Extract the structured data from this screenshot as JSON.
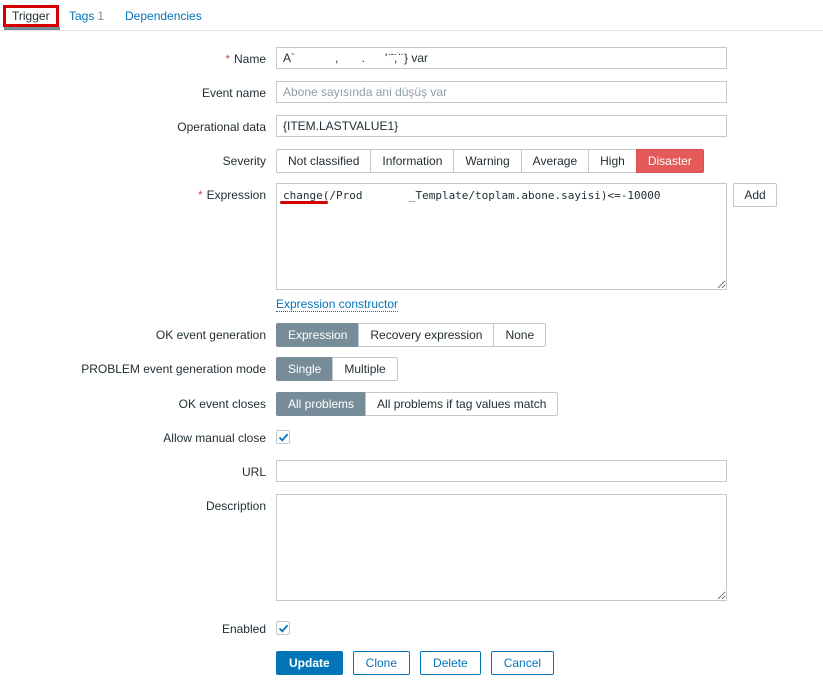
{
  "tabs": {
    "trigger": "Trigger",
    "tags": "Tags",
    "tags_count": "1",
    "dependencies": "Dependencies"
  },
  "form": {
    "name": {
      "label": "Name",
      "value": "A`            ,       .      ' ̈ ̈, ̈ } var"
    },
    "event_name": {
      "label": "Event name",
      "placeholder": "Abone sayısında ani düşüş var"
    },
    "operational_data": {
      "label": "Operational data",
      "value": "{ITEM.LASTVALUE1}"
    },
    "severity": {
      "label": "Severity",
      "options": [
        "Not classified",
        "Information",
        "Warning",
        "Average",
        "High",
        "Disaster"
      ],
      "selected": "Disaster",
      "selected_color": "#e45959"
    },
    "expression": {
      "label": "Expression",
      "value": "change(/Prod       _Template/toplam.abone.sayisi)<=-10000",
      "add_label": "Add",
      "constructor_link": "Expression constructor"
    },
    "ok_event_generation": {
      "label": "OK event generation",
      "options": [
        "Expression",
        "Recovery expression",
        "None"
      ],
      "selected": "Expression"
    },
    "problem_event_mode": {
      "label": "PROBLEM event generation mode",
      "options": [
        "Single",
        "Multiple"
      ],
      "selected": "Single"
    },
    "ok_event_closes": {
      "label": "OK event closes",
      "options": [
        "All problems",
        "All problems if tag values match"
      ],
      "selected": "All problems"
    },
    "allow_manual_close": {
      "label": "Allow manual close",
      "checked": true
    },
    "url": {
      "label": "URL",
      "value": ""
    },
    "description": {
      "label": "Description",
      "value": ""
    },
    "enabled": {
      "label": "Enabled",
      "checked": true
    }
  },
  "actions": {
    "update": "Update",
    "clone": "Clone",
    "delete": "Delete",
    "cancel": "Cancel"
  },
  "colors": {
    "accent": "#0275b8",
    "selected_segment": "#768d99",
    "disaster": "#e45959",
    "highlight_annotation": "#d40000"
  }
}
